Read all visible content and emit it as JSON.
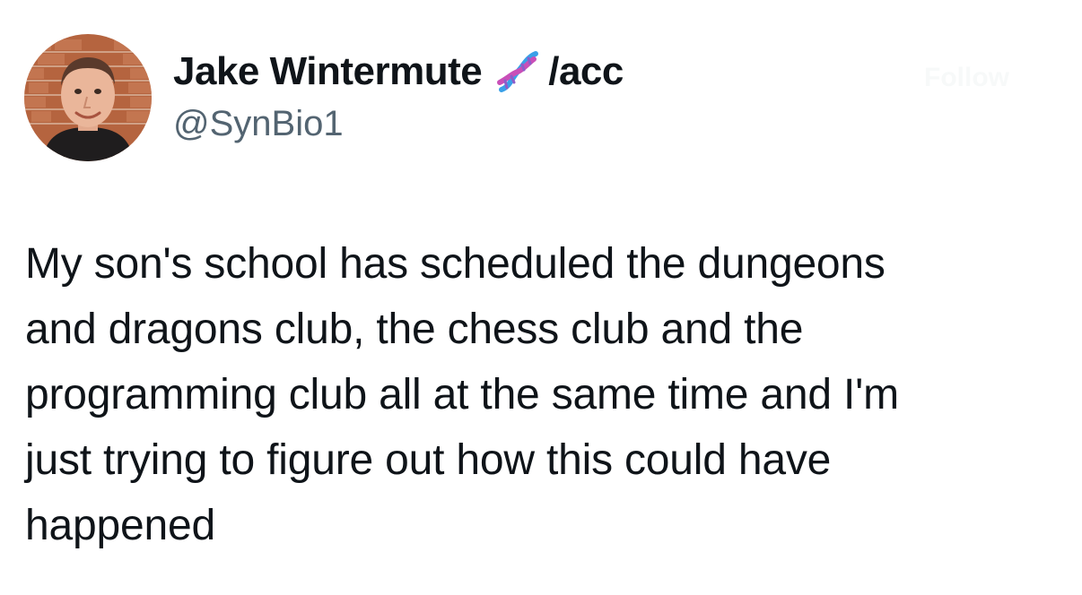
{
  "author": {
    "display_name": "Jake Wintermute",
    "name_emoji": "dna-icon",
    "name_suffix": "/acc",
    "handle": "@SynBio1"
  },
  "ghost_action_label": "Follow",
  "tweet": {
    "lines": [
      "My son's school has scheduled the dungeons",
      "and dragons club, the chess club and the",
      "programming club all at the same time and I'm",
      "just trying to figure out how this could have",
      "happened"
    ]
  },
  "colors": {
    "text_primary": "#0f1419",
    "text_secondary": "#536471",
    "background": "#ffffff"
  }
}
